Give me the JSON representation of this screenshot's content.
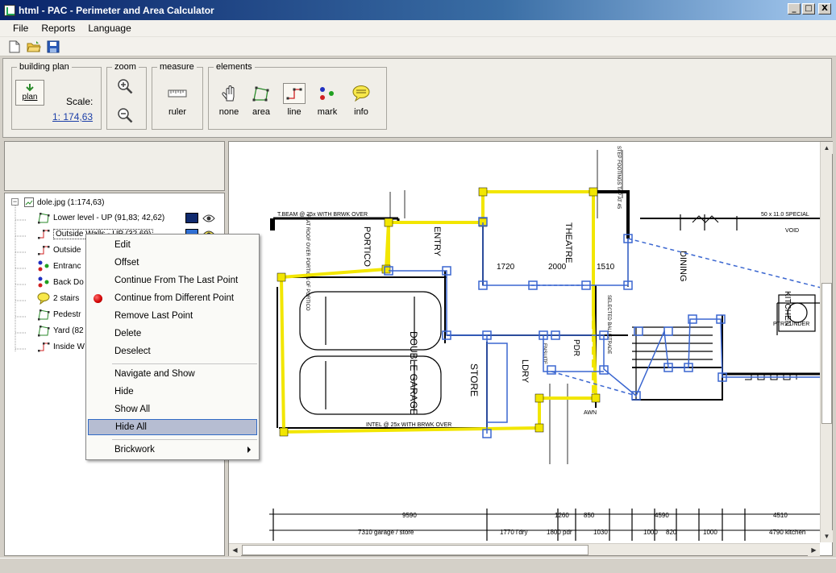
{
  "window": {
    "title": "html - PAC - Perimeter and Area Calculator",
    "buttons": {
      "minimize": "_",
      "maximize": "□",
      "close": "X"
    }
  },
  "menu": [
    "File",
    "Reports",
    "Language"
  ],
  "toolbar": {
    "icons": [
      "new-file-icon",
      "open-folder-icon",
      "save-disk-icon"
    ]
  },
  "ribbon": {
    "building_plan": {
      "legend": "building plan",
      "plan_button": "plan",
      "scale_label": "Scale:",
      "scale_value": "1: 174,63"
    },
    "zoom": {
      "legend": "zoom"
    },
    "measure": {
      "legend": "measure",
      "ruler": "ruler"
    },
    "elements": {
      "legend": "elements",
      "none": "none",
      "area": "area",
      "line": "line",
      "mark": "mark",
      "info": "info",
      "selected": "line"
    }
  },
  "tree": {
    "root": "dole.jpg (1:174,63)",
    "items": [
      {
        "label": "Lower level - UP (91,83; 42,62)",
        "type": "area",
        "color": "#102a6e",
        "visible": true
      },
      {
        "label": "Outside Walls - UP (32,69)",
        "type": "line",
        "color": "#2f6fd4",
        "visible": true
      },
      {
        "label": "Outside",
        "type": "line"
      },
      {
        "label": "Entranc",
        "type": "mark"
      },
      {
        "label": "Back Do",
        "type": "mark"
      },
      {
        "label": "2 stairs",
        "type": "info"
      },
      {
        "label": "Pedestr",
        "type": "area"
      },
      {
        "label": "Yard (82",
        "type": "area"
      },
      {
        "label": "Inside W",
        "type": "line"
      }
    ]
  },
  "context_menu": {
    "items": [
      {
        "label": "Edit"
      },
      {
        "label": "Offset"
      },
      {
        "label": "Continue From The Last Point"
      },
      {
        "label": "Continue from Different Point",
        "icon": "red-dot-icon"
      },
      {
        "label": "Remove Last Point"
      },
      {
        "label": "Delete"
      },
      {
        "label": "Deselect"
      },
      {
        "label": "Navigate and Show"
      },
      {
        "label": "Hide"
      },
      {
        "label": "Show All"
      },
      {
        "label": "Hide All",
        "highlighted": true
      },
      {
        "label": "Brickwork",
        "submenu": true
      }
    ]
  },
  "plan": {
    "rooms": [
      "THEATRE",
      "ENTRY",
      "PORTICO",
      "DOUBLE GARAGE",
      "STORE",
      "LDRY",
      "DINING",
      "KITCHEN",
      "PDR"
    ],
    "dims_top": [
      "1720",
      "2000",
      "1510"
    ],
    "dims_bottom": [
      "9590",
      "1260",
      "850",
      "4590",
      "4510",
      "7310 garage / store",
      "1770 l'dry",
      "1800 pdr",
      "1030",
      "1000",
      "820",
      "1000",
      "4790 kitchen"
    ],
    "notes": [
      "T.BEAM @ 25x WITH BRWK OVER",
      "INTEL @ 25x WITH BRWK OVER",
      "50 x 11.0 SPECIAL",
      "VOID",
      "STEP FOOTINGS TAP AT 45",
      "AWN",
      "PTRY UNDER",
      "SELECTED BALUSTRADE",
      "ENSUITE",
      "FLAT ROOF OVER PORTION OF PORTICO"
    ],
    "colors": {
      "yellow": "#f2e600",
      "blue": "#3a66d0"
    }
  }
}
